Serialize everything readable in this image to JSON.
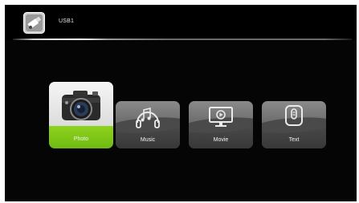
{
  "header": {
    "source_title": "USB1",
    "icon": "usb-drive-icon"
  },
  "media_tiles": [
    {
      "label": "Photo",
      "icon": "camera-icon",
      "selected": true
    },
    {
      "label": "Music",
      "icon": "music-icon",
      "selected": false
    },
    {
      "label": "Movie",
      "icon": "movie-icon",
      "selected": false
    },
    {
      "label": "Text",
      "icon": "text-icon",
      "selected": false
    }
  ],
  "colors": {
    "background": "#050505",
    "selected_accent": "#7dc518",
    "tile_gray": "#6d6d6d"
  }
}
